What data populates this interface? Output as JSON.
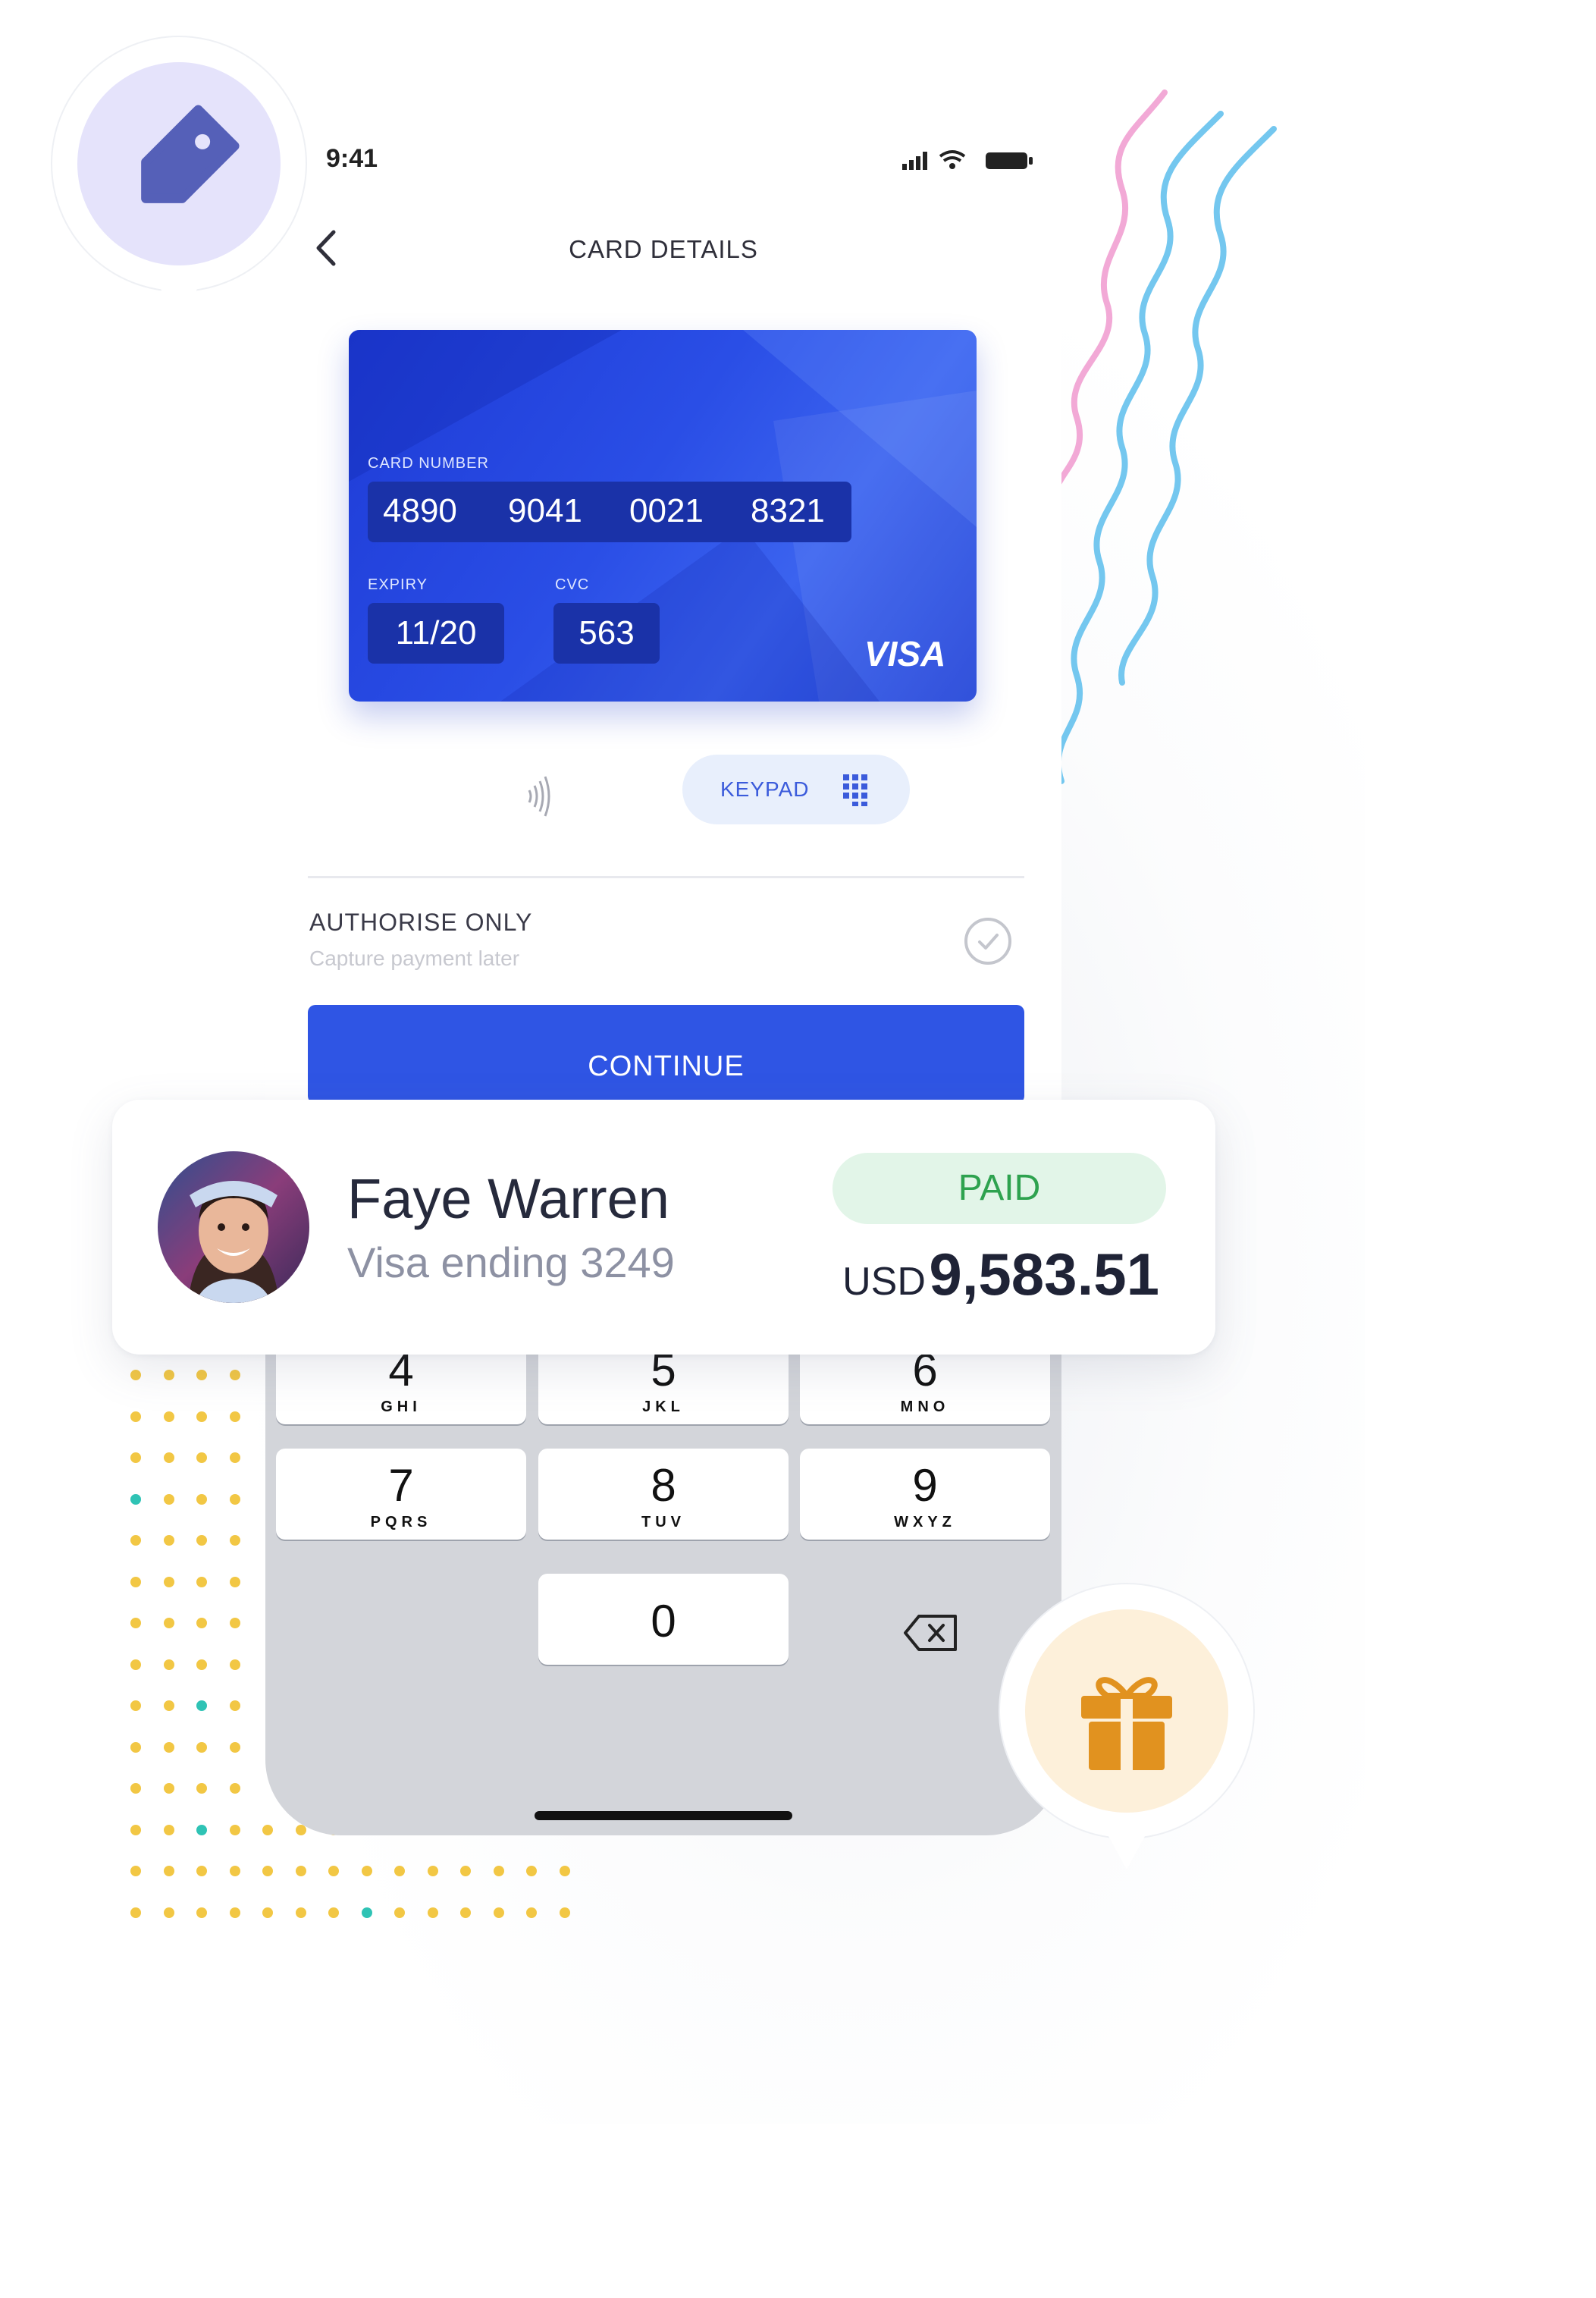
{
  "status_bar": {
    "time": "9:41"
  },
  "header": {
    "title": "CARD DETAILS"
  },
  "card": {
    "number_label": "CARD NUMBER",
    "number_groups": [
      "4890",
      "9041",
      "0021",
      "8321"
    ],
    "expiry_label": "EXPIRY",
    "expiry": "11/20",
    "cvc_label": "CVC",
    "cvc": "563",
    "brand": "VISA",
    "colors": {
      "card": "#2a4ee6",
      "field": "#1a32a8"
    }
  },
  "input_mode": {
    "keypad_label": "KEYPAD"
  },
  "authorise": {
    "title": "AUTHORISE ONLY",
    "subtitle": "Capture payment later"
  },
  "continue_label": "CONTINUE",
  "keypad": {
    "keys": [
      {
        "num": "4",
        "letters": "GHI"
      },
      {
        "num": "5",
        "letters": "JKL"
      },
      {
        "num": "6",
        "letters": "MNO"
      },
      {
        "num": "7",
        "letters": "PQRS"
      },
      {
        "num": "8",
        "letters": "TUV"
      },
      {
        "num": "9",
        "letters": "WXYZ"
      },
      {
        "num": "0",
        "letters": ""
      }
    ]
  },
  "transaction": {
    "name": "Faye Warren",
    "method": "Visa ending 3249",
    "status": "PAID",
    "currency": "USD",
    "amount": "9,583.51"
  },
  "icons": [
    "tag-icon",
    "gift-icon",
    "back-icon",
    "nfc-icon",
    "keypad-grid-icon",
    "check-icon",
    "backspace-icon",
    "signal-icon",
    "wifi-icon",
    "battery-icon"
  ],
  "colors": {
    "primary": "#2f55e4",
    "paid_green": "#2ea24f",
    "paid_bg": "#e2f5e8",
    "tag_bubble": "#e5e3fb",
    "tag": "#5560b8",
    "gift_bubble": "#fdf0da",
    "gift": "#e1921f"
  }
}
